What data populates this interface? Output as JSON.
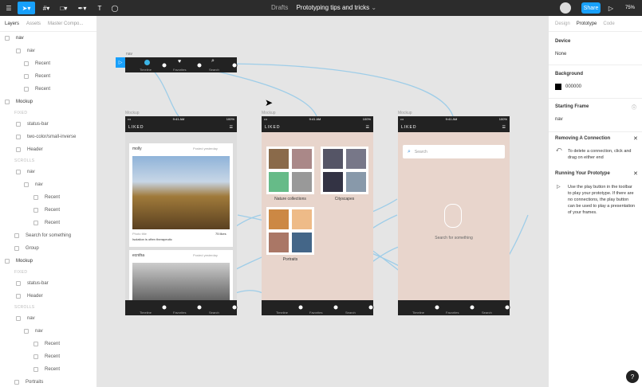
{
  "toolbar": {
    "drafts": "Drafts",
    "file_title": "Prototyping tips and tricks",
    "share": "Share",
    "zoom": "75%"
  },
  "left_tabs": [
    "Layers",
    "Assets",
    "Master Compo..."
  ],
  "layers": [
    "nav",
    "nav",
    "Recent",
    "Recent",
    "Recent",
    "Mockup",
    "FIXED",
    "status-bar",
    "two-color/small-inverse",
    "Header",
    "SCROLLS",
    "nav",
    "nav",
    "Recent",
    "Recent",
    "Recent",
    "Search for something",
    "Group",
    "Mockup",
    "FIXED",
    "status-bar",
    "Header",
    "SCROLLS",
    "nav",
    "nav",
    "Recent",
    "Recent",
    "Recent",
    "Portraits"
  ],
  "right_tabs": [
    "Design",
    "Prototype",
    "Code"
  ],
  "device": {
    "header": "Device",
    "value": "None"
  },
  "background": {
    "header": "Background",
    "value": "000000",
    "color": "#000000"
  },
  "starting_frame": {
    "header": "Starting Frame",
    "value": "nav"
  },
  "removing": {
    "header": "Removing A Connection",
    "text": "To delete a connection, click and drag on either end"
  },
  "running": {
    "header": "Running Your Prototype",
    "text": "Use the play button in the toolbar to play your prototype. If there are no connections, the play button can be used to play a presentation of your frames."
  },
  "canvas": {
    "nav_frame": {
      "label": "nav",
      "items": [
        "Timeline",
        "Favorites",
        "Search"
      ]
    },
    "frame_labels": [
      "Mockup",
      "Mockup",
      "Mockup"
    ],
    "status": {
      "time": "9:41 AM",
      "battery": "100%"
    },
    "brand": "LIKED",
    "feed": {
      "user1": "molly",
      "posted1": "Posted yesterday",
      "caption_user": "Photo title",
      "caption": "Isolation is often therapeutic",
      "likes": "75 likes",
      "user2": "ecntha",
      "posted2": "Posted yesterday"
    },
    "collections": [
      "Nature collections",
      "Cityscapes",
      "Portraits"
    ],
    "search": {
      "placeholder": "Search",
      "empty": "Search for something"
    }
  }
}
